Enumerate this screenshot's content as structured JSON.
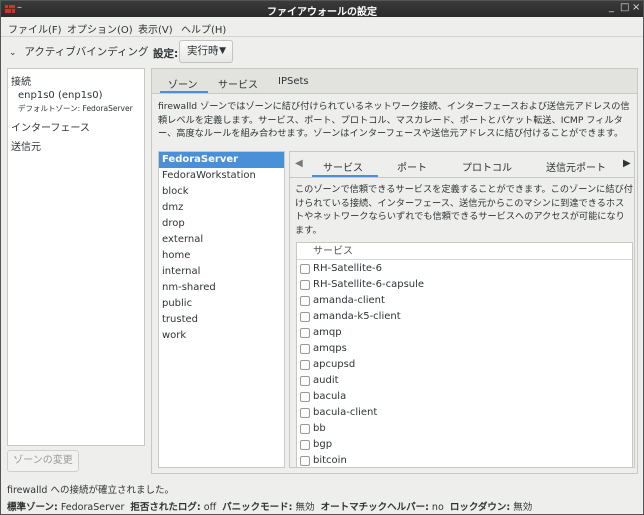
{
  "window": {
    "title": "ファイアウォールの設定",
    "menu_glyph": "–",
    "controls": [
      "_",
      "□",
      "×"
    ]
  },
  "menubar": [
    "ファイル(F)",
    "オプション(O)",
    "表示(V)",
    "ヘルプ(H)"
  ],
  "left": {
    "view_toggle": "アクティブバインディング",
    "sections": {
      "connections": "接続",
      "connection_name": "enp1s0 (enp1s0)",
      "default_zone_label": "デフォルトゾーン: FedoraServer",
      "interfaces": "インターフェース",
      "sources": "送信元"
    },
    "change_zone_button": "ゾーンの変更"
  },
  "settings": {
    "label": "設定:",
    "value": "実行時"
  },
  "main_tabs": [
    "ゾーン",
    "サービス",
    "IPSets"
  ],
  "zone_description": "firewalld ゾーンではゾーンに結び付けられているネットワーク接続、インターフェースおよび送信元アドレスの信頼レベルを定義します。サービス、ポート、プロトコル、マスカレード、ポートとパケット転送、ICMP フィルター、高度なルールを組み合わせます。ゾーンはインターフェースや送信元アドレスに結び付けることができます。",
  "zones": [
    "FedoraServer",
    "FedoraWorkstation",
    "block",
    "dmz",
    "drop",
    "external",
    "home",
    "internal",
    "nm-shared",
    "public",
    "trusted",
    "work"
  ],
  "selected_zone": "FedoraServer",
  "inner_tabs": [
    "サービス",
    "ポート",
    "プロトコル",
    "送信元ポート"
  ],
  "inner_description": "このゾーンで信頼できるサービスを定義することができます。このゾーンに結び付けられている接続、インターフェース、送信元からこのマシンに到達できるホストやネットワークならいずれでも信頼できるサービスへのアクセスが可能になります。",
  "services_header": "サービス",
  "services": [
    "RH-Satellite-6",
    "RH-Satellite-6-capsule",
    "amanda-client",
    "amanda-k5-client",
    "amqp",
    "amqps",
    "apcupsd",
    "audit",
    "bacula",
    "bacula-client",
    "bb",
    "bgp",
    "bitcoin"
  ],
  "status": {
    "connection": "firewalld への接続が確立されました。",
    "default_zone_label": "標準ゾーン:",
    "default_zone": "FedoraServer",
    "log_denied_label": "拒否されたログ:",
    "log_denied": "off",
    "panic_label": "パニックモード:",
    "panic": "無効",
    "helper_label": "オートマチックヘルパー:",
    "helper": "no",
    "lockdown_label": "ロックダウン:",
    "lockdown": "無効"
  },
  "colors": {
    "accent": "#4a90d9",
    "titlebar": "#2f2f2f"
  }
}
